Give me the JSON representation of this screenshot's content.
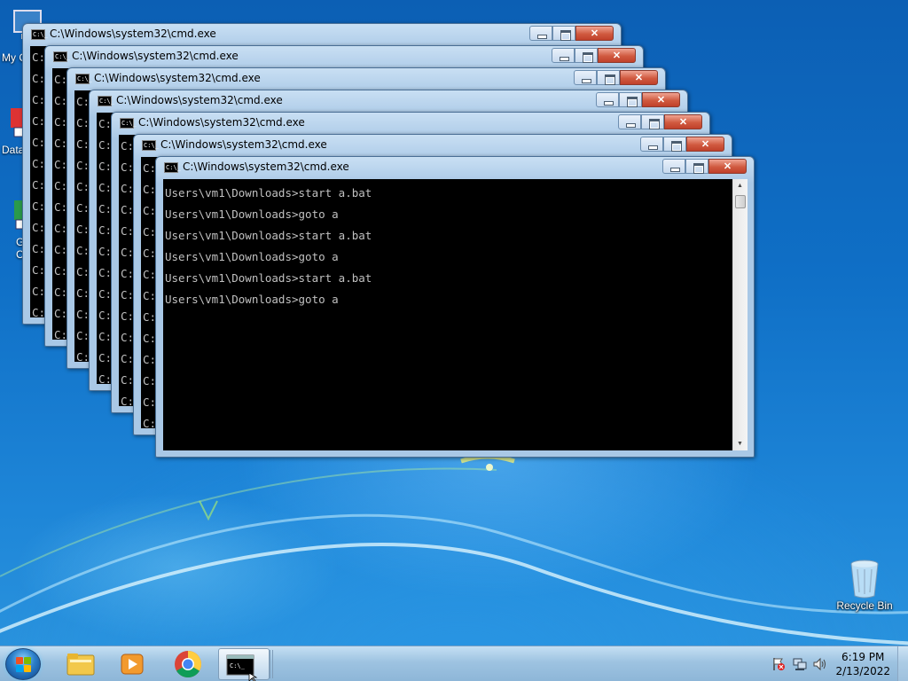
{
  "desktop": {
    "icons": [
      {
        "id": "my-computer",
        "label": "My C",
        "visible_fragment": true
      },
      {
        "id": "data",
        "label": "Data",
        "visible_fragment": true
      },
      {
        "id": "g",
        "label": "G\nC",
        "visible_fragment": true
      },
      {
        "id": "recycle-bin",
        "label": "Recycle Bin"
      }
    ]
  },
  "windows": [
    {
      "title": "C:\\Windows\\system32\\cmd.exe",
      "lines": [
        "C:",
        "C:",
        "C:",
        "C:",
        "C:",
        "C:",
        "C:",
        "C:",
        "C:",
        "C:",
        "C:",
        "C:",
        "C:"
      ]
    },
    {
      "title": "C:\\Windows\\system32\\cmd.exe",
      "lines": [
        "C:",
        "C:",
        "C:",
        "C:",
        "C:",
        "C:",
        "C:",
        "C:",
        "C:",
        "C:",
        "C:",
        "C:",
        "C:"
      ]
    },
    {
      "title": "C:\\Windows\\system32\\cmd.exe",
      "lines": [
        "C:",
        "C:",
        "C:",
        "C:",
        "C:",
        "C:",
        "C:",
        "C:",
        "C:",
        "C:",
        "C:",
        "C:",
        "C:"
      ]
    },
    {
      "title": "C:\\Windows\\system32\\cmd.exe",
      "lines": [
        "C:",
        "C:",
        "C:",
        "C:",
        "C:",
        "C:",
        "C:",
        "C:",
        "C:",
        "C:",
        "C:",
        "C:",
        "C:"
      ]
    },
    {
      "title": "C:\\Windows\\system32\\cmd.exe",
      "lines": [
        "C:",
        "C:",
        "C:",
        "C:",
        "C:",
        "C:",
        "C:",
        "C:",
        "C:",
        "C:",
        "C:",
        "C:",
        "C:"
      ]
    },
    {
      "title": "C:\\Windows\\system32\\cmd.exe",
      "lines": [
        "C:",
        "C:",
        "C:",
        "C:",
        "C:",
        "C:",
        "C:",
        "C:",
        "C:",
        "C:",
        "C:",
        "C:",
        "C:"
      ]
    },
    {
      "title": "C:\\Windows\\system32\\cmd.exe",
      "lines": [
        "Users\\vm1\\Downloads>start a.bat",
        "Users\\vm1\\Downloads>goto a",
        "Users\\vm1\\Downloads>start a.bat",
        "Users\\vm1\\Downloads>goto a",
        "Users\\vm1\\Downloads>start a.bat",
        "Users\\vm1\\Downloads>goto a"
      ]
    }
  ],
  "window_icon_text": "C:\\_",
  "taskbar": {
    "start_label": "Start",
    "pinned": [
      "Windows Explorer",
      "Windows Media Player",
      "Google Chrome",
      "Command Prompt"
    ],
    "clock_time": "6:19 PM",
    "clock_date": "2/13/2022"
  },
  "colors": {
    "console_bg": "#000000",
    "console_text": "#c0c0c0",
    "close_button": "#c8472e",
    "window_frame": "#a9c8e6"
  }
}
